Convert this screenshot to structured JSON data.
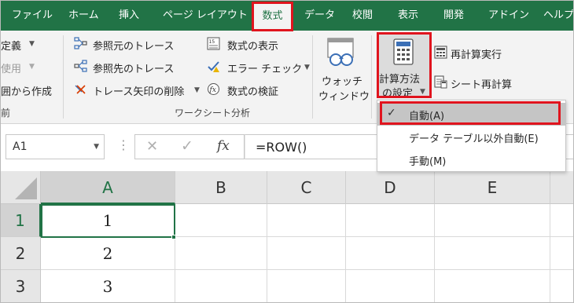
{
  "tabs": [
    "ファイル",
    "ホーム",
    "挿入",
    "ページ レイアウト",
    "数式",
    "データ",
    "校閲",
    "表示",
    "開発",
    "アドイン",
    "ヘルプ"
  ],
  "active_tab": "数式",
  "ribbon": {
    "left_partial": {
      "row1": "定義",
      "row2": "使用",
      "row3": "囲から作成",
      "group_label": "前"
    },
    "formula_auditing": {
      "trace_precedents": "参照元のトレース",
      "trace_dependents": "参照先のトレース",
      "remove_arrows": "トレース矢印の削除",
      "show_formulas": "数式の表示",
      "error_checking": "エラー チェック",
      "evaluate_formula": "数式の検証",
      "group_label": "ワークシート分析"
    },
    "watch_window": {
      "line1": "ウォッチ",
      "line2": "ウィンドウ"
    },
    "calculation": {
      "options_line1": "計算方法",
      "options_line2": "の設定",
      "calc_now": "再計算実行",
      "calc_sheet": "シート再計算"
    }
  },
  "calc_menu": {
    "items": [
      "自動(A)",
      "データ テーブル以外自動(E)",
      "手動(M)"
    ],
    "selected": "自動(A)"
  },
  "formula_bar": {
    "name_box": "A1",
    "fx": "fx",
    "formula": "=ROW()"
  },
  "grid": {
    "columns": [
      "A",
      "B",
      "C",
      "D",
      "E"
    ],
    "rows": [
      "1",
      "2",
      "3"
    ],
    "values": [
      "1",
      "2",
      "3"
    ]
  },
  "colors": {
    "excel_green": "#217346",
    "highlight_red": "#e0141e"
  }
}
